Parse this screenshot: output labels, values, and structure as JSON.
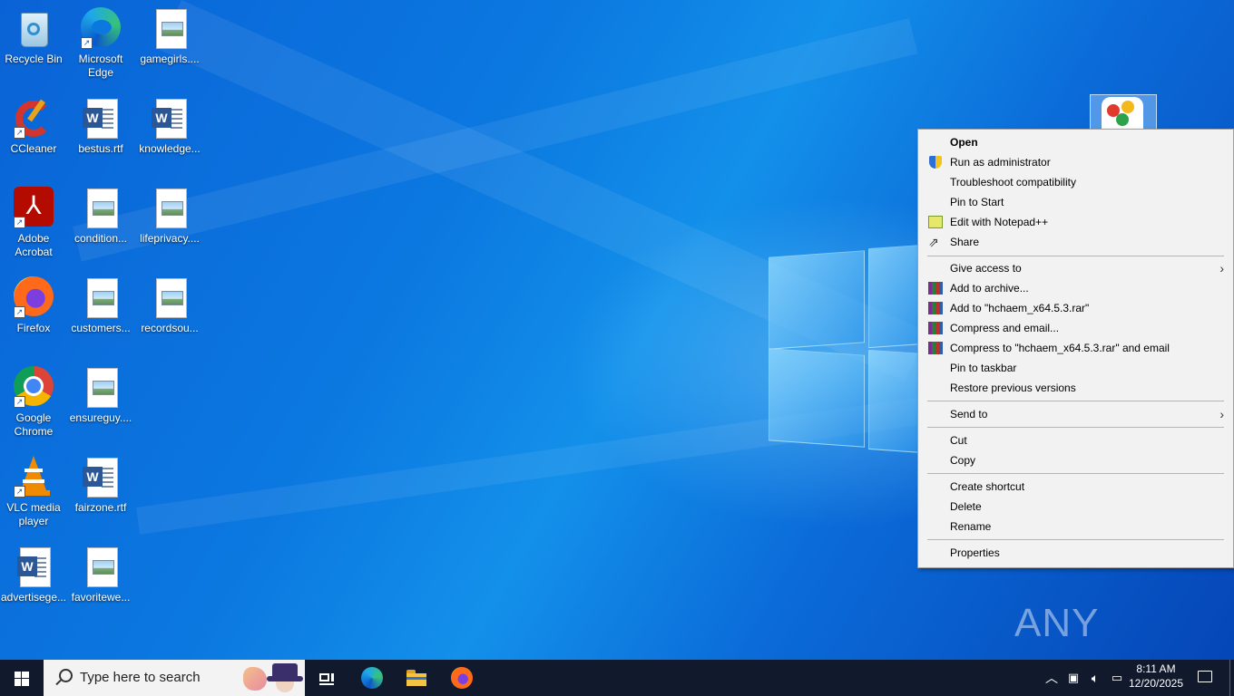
{
  "desktop_icons": [
    {
      "label": "Recycle Bin",
      "icon": "recycle-bin-icon"
    },
    {
      "label": "Microsoft Edge",
      "icon": "edge-icon"
    },
    {
      "label": "gamegirls....",
      "icon": "image-file-icon"
    },
    {
      "label": "CCleaner",
      "icon": "ccleaner-icon"
    },
    {
      "label": "bestus.rtf",
      "icon": "word-doc-icon"
    },
    {
      "label": "knowledge...",
      "icon": "word-doc-icon"
    },
    {
      "label": "Adobe Acrobat",
      "icon": "acrobat-icon"
    },
    {
      "label": "condition...",
      "icon": "image-file-icon"
    },
    {
      "label": "lifeprivacy....",
      "icon": "image-file-icon"
    },
    {
      "label": "Firefox",
      "icon": "firefox-icon"
    },
    {
      "label": "customers...",
      "icon": "image-file-icon"
    },
    {
      "label": "recordsou...",
      "icon": "image-file-icon"
    },
    {
      "label": "Google Chrome",
      "icon": "chrome-icon"
    },
    {
      "label": "ensureguy....",
      "icon": "image-file-icon"
    },
    {
      "label": "VLC media player",
      "icon": "vlc-icon"
    },
    {
      "label": "fairzone.rtf",
      "icon": "word-doc-icon"
    },
    {
      "label": "advertisege...",
      "icon": "word-doc-icon"
    },
    {
      "label": "favoritewe...",
      "icon": "image-file-icon"
    }
  ],
  "context_menu": {
    "items": [
      {
        "label": "Open",
        "bold": true
      },
      {
        "label": "Run as administrator",
        "icon": "uac-shield-icon"
      },
      {
        "label": "Troubleshoot compatibility"
      },
      {
        "label": "Pin to Start"
      },
      {
        "label": "Edit with Notepad++",
        "icon": "notepad-plus-plus-icon"
      },
      {
        "label": "Share",
        "icon": "share-icon"
      },
      {
        "label": "Give access to",
        "submenu": true
      },
      {
        "label": "Add to archive...",
        "icon": "winrar-icon"
      },
      {
        "label": "Add to \"hchaem_x64.5.3.rar\"",
        "icon": "winrar-icon"
      },
      {
        "label": "Compress and email...",
        "icon": "winrar-icon"
      },
      {
        "label": "Compress to \"hchaem_x64.5.3.rar\" and email",
        "icon": "winrar-icon"
      },
      {
        "label": "Pin to taskbar"
      },
      {
        "label": "Restore previous versions"
      },
      {
        "label": "Send to",
        "submenu": true
      },
      {
        "label": "Cut"
      },
      {
        "label": "Copy"
      },
      {
        "label": "Create shortcut"
      },
      {
        "label": "Delete"
      },
      {
        "label": "Rename"
      },
      {
        "label": "Properties"
      }
    ]
  },
  "watermark": "ANY RUN",
  "taskbar": {
    "search_placeholder": "Type here to search",
    "pinned": [
      "task-view-icon",
      "edge-icon",
      "file-explorer-icon",
      "firefox-icon"
    ],
    "tray_icons": [
      "chevron-up-icon",
      "meet-now-icon",
      "volume-icon",
      "network-icon"
    ],
    "time": "8:11 AM",
    "date": "12/20/2025"
  },
  "colors": {
    "desktop_blue": "#0b78e0",
    "taskbar": "#101a2c",
    "menu_bg": "#f2f2f2"
  }
}
